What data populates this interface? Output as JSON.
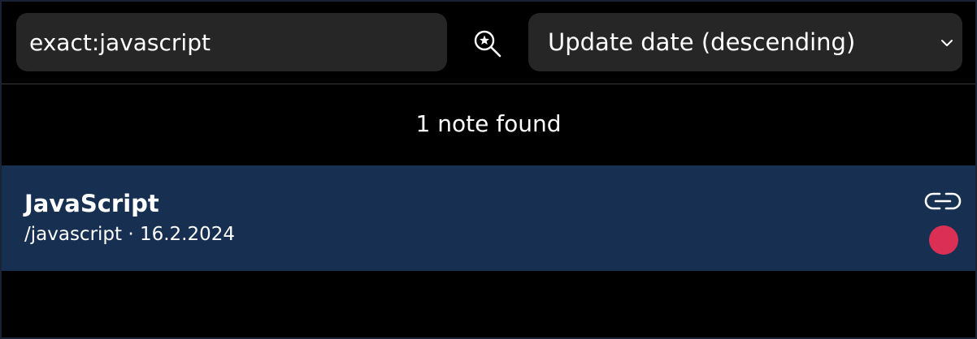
{
  "search": {
    "value": "exact:javascript",
    "icon": "search-star-icon"
  },
  "sort": {
    "selected": "Update date (descending)",
    "icon": "chevron-down-icon"
  },
  "results": {
    "count_text": "1 note found"
  },
  "notes": [
    {
      "title": "JavaScript",
      "meta": "/javascript · 16.2.2024",
      "link_icon": "link-icon",
      "status_color": "#dc2f55"
    }
  ],
  "colors": {
    "background": "#000000",
    "field_bg": "#262626",
    "row_selected_bg": "#173052",
    "status_dot": "#dc2f55"
  }
}
